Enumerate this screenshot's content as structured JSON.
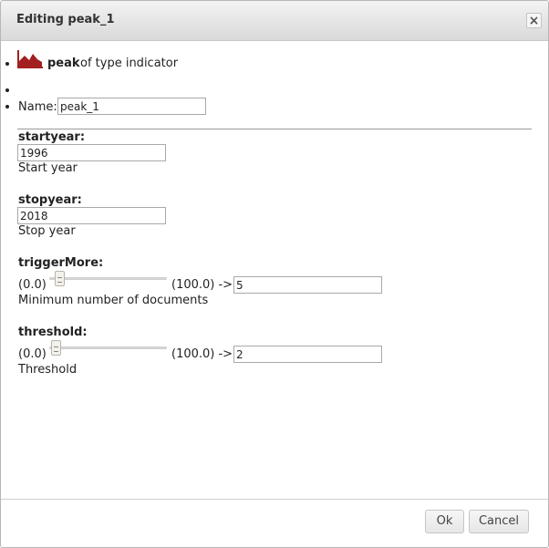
{
  "dialog": {
    "title": "Editing peak_1",
    "close_icon": "close-icon"
  },
  "header": {
    "icon": "area-chart-icon",
    "icon_color": "#a31f1f",
    "name": "peak",
    "type_text": "of type indicator"
  },
  "name_field": {
    "label": "Name:",
    "value": "peak_1"
  },
  "params": {
    "startyear": {
      "title": "startyear:",
      "value": "1996",
      "desc": "Start year"
    },
    "stopyear": {
      "title": "stopyear:",
      "value": "2018",
      "desc": "Stop year"
    },
    "triggerMore": {
      "title": "triggerMore:",
      "min_label": "(0.0)",
      "max_label": "(100.0) ->",
      "value": "5",
      "level": 0.05,
      "desc": "Minimum number of documents"
    },
    "threshold": {
      "title": "threshold:",
      "min_label": "(0.0)",
      "max_label": "(100.0) ->",
      "value": "2",
      "level": 0.02,
      "desc": "Threshold"
    }
  },
  "buttons": {
    "ok": "Ok",
    "cancel": "Cancel"
  }
}
